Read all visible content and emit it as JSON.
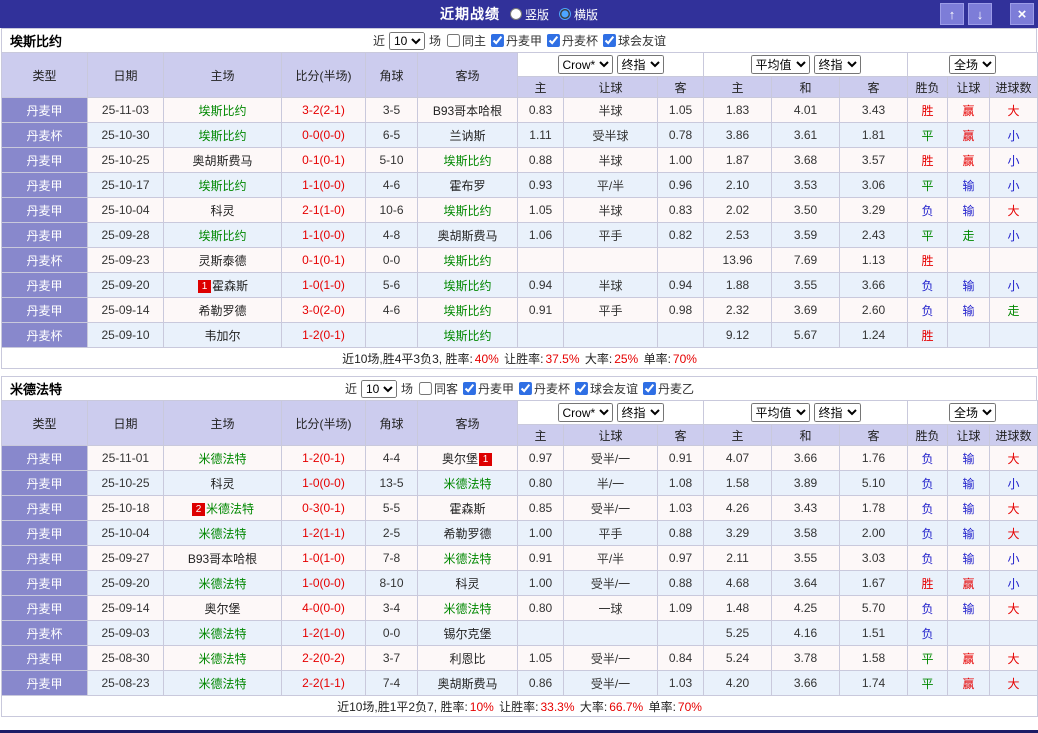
{
  "topbar": {
    "title": "近期战绩",
    "radios": [
      {
        "label": "竖版",
        "selected": false
      },
      {
        "label": "横版",
        "selected": true
      }
    ],
    "up_icon": "↑",
    "down_icon": "↓",
    "close_icon": "×"
  },
  "columns": [
    "类型",
    "日期",
    "主场",
    "比分(半场)",
    "角球",
    "客场",
    "主",
    "让球",
    "客",
    "主",
    "和",
    "客",
    "胜负",
    "让球",
    "进球数"
  ],
  "header_selects": {
    "asia": [
      "Crow*",
      "终指"
    ],
    "europe": [
      "平均值",
      "终指"
    ],
    "result": [
      "全场"
    ]
  },
  "result_colors": {
    "胜": "#e60000",
    "平": "#008800",
    "负": "#2222cc",
    "赢": "#e60000",
    "输": "#2222cc",
    "走": "#008800",
    "大": "#e60000",
    "小": "#2222cc"
  },
  "sections": [
    {
      "team": "埃斯比约",
      "filter": {
        "near": "近",
        "count": "10",
        "games": "场",
        "same": {
          "label": "同主",
          "checked": false
        },
        "leagues": [
          {
            "label": "丹麦甲",
            "checked": true
          },
          {
            "label": "丹麦杯",
            "checked": true
          },
          {
            "label": "球会友谊",
            "checked": true
          }
        ]
      },
      "rows": [
        {
          "type": "丹麦甲",
          "date": "25-11-03",
          "home": {
            "name": "埃斯比约",
            "focus": true
          },
          "score": "3-2(2-1)",
          "corner": "3-5",
          "away": {
            "name": "B93哥本哈根",
            "focus": false
          },
          "asia": [
            "0.83",
            "半球",
            "1.05"
          ],
          "europe": [
            "1.83",
            "4.01",
            "3.43"
          ],
          "outcome": [
            "胜",
            "赢",
            "大"
          ]
        },
        {
          "type": "丹麦杯",
          "date": "25-10-30",
          "home": {
            "name": "埃斯比约",
            "focus": true
          },
          "score": "0-0(0-0)",
          "corner": "6-5",
          "away": {
            "name": "兰讷斯",
            "focus": false
          },
          "asia": [
            "1.11",
            "受半球",
            "0.78"
          ],
          "europe": [
            "3.86",
            "3.61",
            "1.81"
          ],
          "outcome": [
            "平",
            "赢",
            "小"
          ]
        },
        {
          "type": "丹麦甲",
          "date": "25-10-25",
          "home": {
            "name": "奥胡斯费马",
            "focus": false
          },
          "score": "0-1(0-1)",
          "corner": "5-10",
          "away": {
            "name": "埃斯比约",
            "focus": true
          },
          "asia": [
            "0.88",
            "半球",
            "1.00"
          ],
          "europe": [
            "1.87",
            "3.68",
            "3.57"
          ],
          "outcome": [
            "胜",
            "赢",
            "小"
          ]
        },
        {
          "type": "丹麦甲",
          "date": "25-10-17",
          "home": {
            "name": "埃斯比约",
            "focus": true
          },
          "score": "1-1(0-0)",
          "corner": "4-6",
          "away": {
            "name": "霍布罗",
            "focus": false
          },
          "asia": [
            "0.93",
            "平/半",
            "0.96"
          ],
          "europe": [
            "2.10",
            "3.53",
            "3.06"
          ],
          "outcome": [
            "平",
            "输",
            "小"
          ]
        },
        {
          "type": "丹麦甲",
          "date": "25-10-04",
          "home": {
            "name": "科灵",
            "focus": false
          },
          "score": "2-1(1-0)",
          "corner": "10-6",
          "away": {
            "name": "埃斯比约",
            "focus": true
          },
          "asia": [
            "1.05",
            "半球",
            "0.83"
          ],
          "europe": [
            "2.02",
            "3.50",
            "3.29"
          ],
          "outcome": [
            "负",
            "输",
            "大"
          ]
        },
        {
          "type": "丹麦甲",
          "date": "25-09-28",
          "home": {
            "name": "埃斯比约",
            "focus": true
          },
          "score": "1-1(0-0)",
          "corner": "4-8",
          "away": {
            "name": "奥胡斯费马",
            "focus": false
          },
          "asia": [
            "1.06",
            "平手",
            "0.82"
          ],
          "europe": [
            "2.53",
            "3.59",
            "2.43"
          ],
          "outcome": [
            "平",
            "走",
            "小"
          ]
        },
        {
          "type": "丹麦杯",
          "date": "25-09-23",
          "home": {
            "name": "灵斯泰德",
            "focus": false
          },
          "score": "0-1(0-1)",
          "corner": "0-0",
          "away": {
            "name": "埃斯比约",
            "focus": true
          },
          "asia": [
            "",
            "",
            ""
          ],
          "europe": [
            "13.96",
            "7.69",
            "1.13"
          ],
          "outcome": [
            "胜",
            "",
            ""
          ]
        },
        {
          "type": "丹麦甲",
          "date": "25-09-20",
          "home": {
            "name": "霍森斯",
            "focus": false,
            "badge": "1",
            "badge_pos": "before"
          },
          "score": "1-0(1-0)",
          "corner": "5-6",
          "away": {
            "name": "埃斯比约",
            "focus": true
          },
          "asia": [
            "0.94",
            "半球",
            "0.94"
          ],
          "europe": [
            "1.88",
            "3.55",
            "3.66"
          ],
          "outcome": [
            "负",
            "输",
            "小"
          ]
        },
        {
          "type": "丹麦甲",
          "date": "25-09-14",
          "home": {
            "name": "希勒罗德",
            "focus": false
          },
          "score": "3-0(2-0)",
          "corner": "4-6",
          "away": {
            "name": "埃斯比约",
            "focus": true
          },
          "asia": [
            "0.91",
            "平手",
            "0.98"
          ],
          "europe": [
            "2.32",
            "3.69",
            "2.60"
          ],
          "outcome": [
            "负",
            "输",
            "走"
          ]
        },
        {
          "type": "丹麦杯",
          "date": "25-09-10",
          "home": {
            "name": "韦加尔",
            "focus": false
          },
          "score": "1-2(0-1)",
          "corner": "",
          "away": {
            "name": "埃斯比约",
            "focus": true
          },
          "asia": [
            "",
            "",
            ""
          ],
          "europe": [
            "9.12",
            "5.67",
            "1.24"
          ],
          "outcome": [
            "胜",
            "",
            ""
          ]
        }
      ],
      "summary": [
        {
          "text": "近10场,胜4平3负3, 胜率:",
          "red": false
        },
        {
          "text": "40%",
          "red": true
        },
        {
          "text": " 让胜率:",
          "red": false
        },
        {
          "text": "37.5%",
          "red": true
        },
        {
          "text": " 大率:",
          "red": false
        },
        {
          "text": "25%",
          "red": true
        },
        {
          "text": " 单率:",
          "red": false
        },
        {
          "text": "70%",
          "red": true
        }
      ]
    },
    {
      "team": "米德法特",
      "filter": {
        "near": "近",
        "count": "10",
        "games": "场",
        "same": {
          "label": "同客",
          "checked": false
        },
        "leagues": [
          {
            "label": "丹麦甲",
            "checked": true
          },
          {
            "label": "丹麦杯",
            "checked": true
          },
          {
            "label": "球会友谊",
            "checked": true
          },
          {
            "label": "丹麦乙",
            "checked": true
          }
        ]
      },
      "rows": [
        {
          "type": "丹麦甲",
          "date": "25-11-01",
          "home": {
            "name": "米德法特",
            "focus": true
          },
          "score": "1-2(0-1)",
          "corner": "4-4",
          "away": {
            "name": "奥尔堡",
            "focus": false,
            "badge": "1",
            "badge_pos": "after"
          },
          "asia": [
            "0.97",
            "受半/一",
            "0.91"
          ],
          "europe": [
            "4.07",
            "3.66",
            "1.76"
          ],
          "outcome": [
            "负",
            "输",
            "大"
          ]
        },
        {
          "type": "丹麦甲",
          "date": "25-10-25",
          "home": {
            "name": "科灵",
            "focus": false
          },
          "score": "1-0(0-0)",
          "corner": "13-5",
          "away": {
            "name": "米德法特",
            "focus": true
          },
          "asia": [
            "0.80",
            "半/一",
            "1.08"
          ],
          "europe": [
            "1.58",
            "3.89",
            "5.10"
          ],
          "outcome": [
            "负",
            "输",
            "小"
          ]
        },
        {
          "type": "丹麦甲",
          "date": "25-10-18",
          "home": {
            "name": "米德法特",
            "focus": true,
            "badge": "2",
            "badge_pos": "before"
          },
          "score": "0-3(0-1)",
          "corner": "5-5",
          "away": {
            "name": "霍森斯",
            "focus": false
          },
          "asia": [
            "0.85",
            "受半/一",
            "1.03"
          ],
          "europe": [
            "4.26",
            "3.43",
            "1.78"
          ],
          "outcome": [
            "负",
            "输",
            "大"
          ]
        },
        {
          "type": "丹麦甲",
          "date": "25-10-04",
          "home": {
            "name": "米德法特",
            "focus": true
          },
          "score": "1-2(1-1)",
          "corner": "2-5",
          "away": {
            "name": "希勒罗德",
            "focus": false
          },
          "asia": [
            "1.00",
            "平手",
            "0.88"
          ],
          "europe": [
            "3.29",
            "3.58",
            "2.00"
          ],
          "outcome": [
            "负",
            "输",
            "大"
          ]
        },
        {
          "type": "丹麦甲",
          "date": "25-09-27",
          "home": {
            "name": "B93哥本哈根",
            "focus": false
          },
          "score": "1-0(1-0)",
          "corner": "7-8",
          "away": {
            "name": "米德法特",
            "focus": true
          },
          "asia": [
            "0.91",
            "平/半",
            "0.97"
          ],
          "europe": [
            "2.11",
            "3.55",
            "3.03"
          ],
          "outcome": [
            "负",
            "输",
            "小"
          ]
        },
        {
          "type": "丹麦甲",
          "date": "25-09-20",
          "home": {
            "name": "米德法特",
            "focus": true
          },
          "score": "1-0(0-0)",
          "corner": "8-10",
          "away": {
            "name": "科灵",
            "focus": false
          },
          "asia": [
            "1.00",
            "受半/一",
            "0.88"
          ],
          "europe": [
            "4.68",
            "3.64",
            "1.67"
          ],
          "outcome": [
            "胜",
            "赢",
            "小"
          ]
        },
        {
          "type": "丹麦甲",
          "date": "25-09-14",
          "home": {
            "name": "奥尔堡",
            "focus": false
          },
          "score": "4-0(0-0)",
          "corner": "3-4",
          "away": {
            "name": "米德法特",
            "focus": true
          },
          "asia": [
            "0.80",
            "一球",
            "1.09"
          ],
          "europe": [
            "1.48",
            "4.25",
            "5.70"
          ],
          "outcome": [
            "负",
            "输",
            "大"
          ]
        },
        {
          "type": "丹麦杯",
          "date": "25-09-03",
          "home": {
            "name": "米德法特",
            "focus": true
          },
          "score": "1-2(1-0)",
          "corner": "0-0",
          "away": {
            "name": "锡尔克堡",
            "focus": false
          },
          "asia": [
            "",
            "",
            ""
          ],
          "europe": [
            "5.25",
            "4.16",
            "1.51"
          ],
          "outcome": [
            "负",
            "",
            ""
          ]
        },
        {
          "type": "丹麦甲",
          "date": "25-08-30",
          "home": {
            "name": "米德法特",
            "focus": true
          },
          "score": "2-2(0-2)",
          "corner": "3-7",
          "away": {
            "name": "利恩比",
            "focus": false
          },
          "asia": [
            "1.05",
            "受半/一",
            "0.84"
          ],
          "europe": [
            "5.24",
            "3.78",
            "1.58"
          ],
          "outcome": [
            "平",
            "赢",
            "大"
          ]
        },
        {
          "type": "丹麦甲",
          "date": "25-08-23",
          "home": {
            "name": "米德法特",
            "focus": true
          },
          "score": "2-2(1-1)",
          "corner": "7-4",
          "away": {
            "name": "奥胡斯费马",
            "focus": false
          },
          "asia": [
            "0.86",
            "受半/一",
            "1.03"
          ],
          "europe": [
            "4.20",
            "3.66",
            "1.74"
          ],
          "outcome": [
            "平",
            "赢",
            "大"
          ]
        }
      ],
      "summary": [
        {
          "text": "近10场,胜1平2负7, 胜率:",
          "red": false
        },
        {
          "text": "10%",
          "red": true
        },
        {
          "text": " 让胜率:",
          "red": false
        },
        {
          "text": "33.3%",
          "red": true
        },
        {
          "text": " 大率:",
          "red": false
        },
        {
          "text": "66.7%",
          "red": true
        },
        {
          "text": " 单率:",
          "red": false
        },
        {
          "text": "70%",
          "red": true
        }
      ]
    }
  ]
}
